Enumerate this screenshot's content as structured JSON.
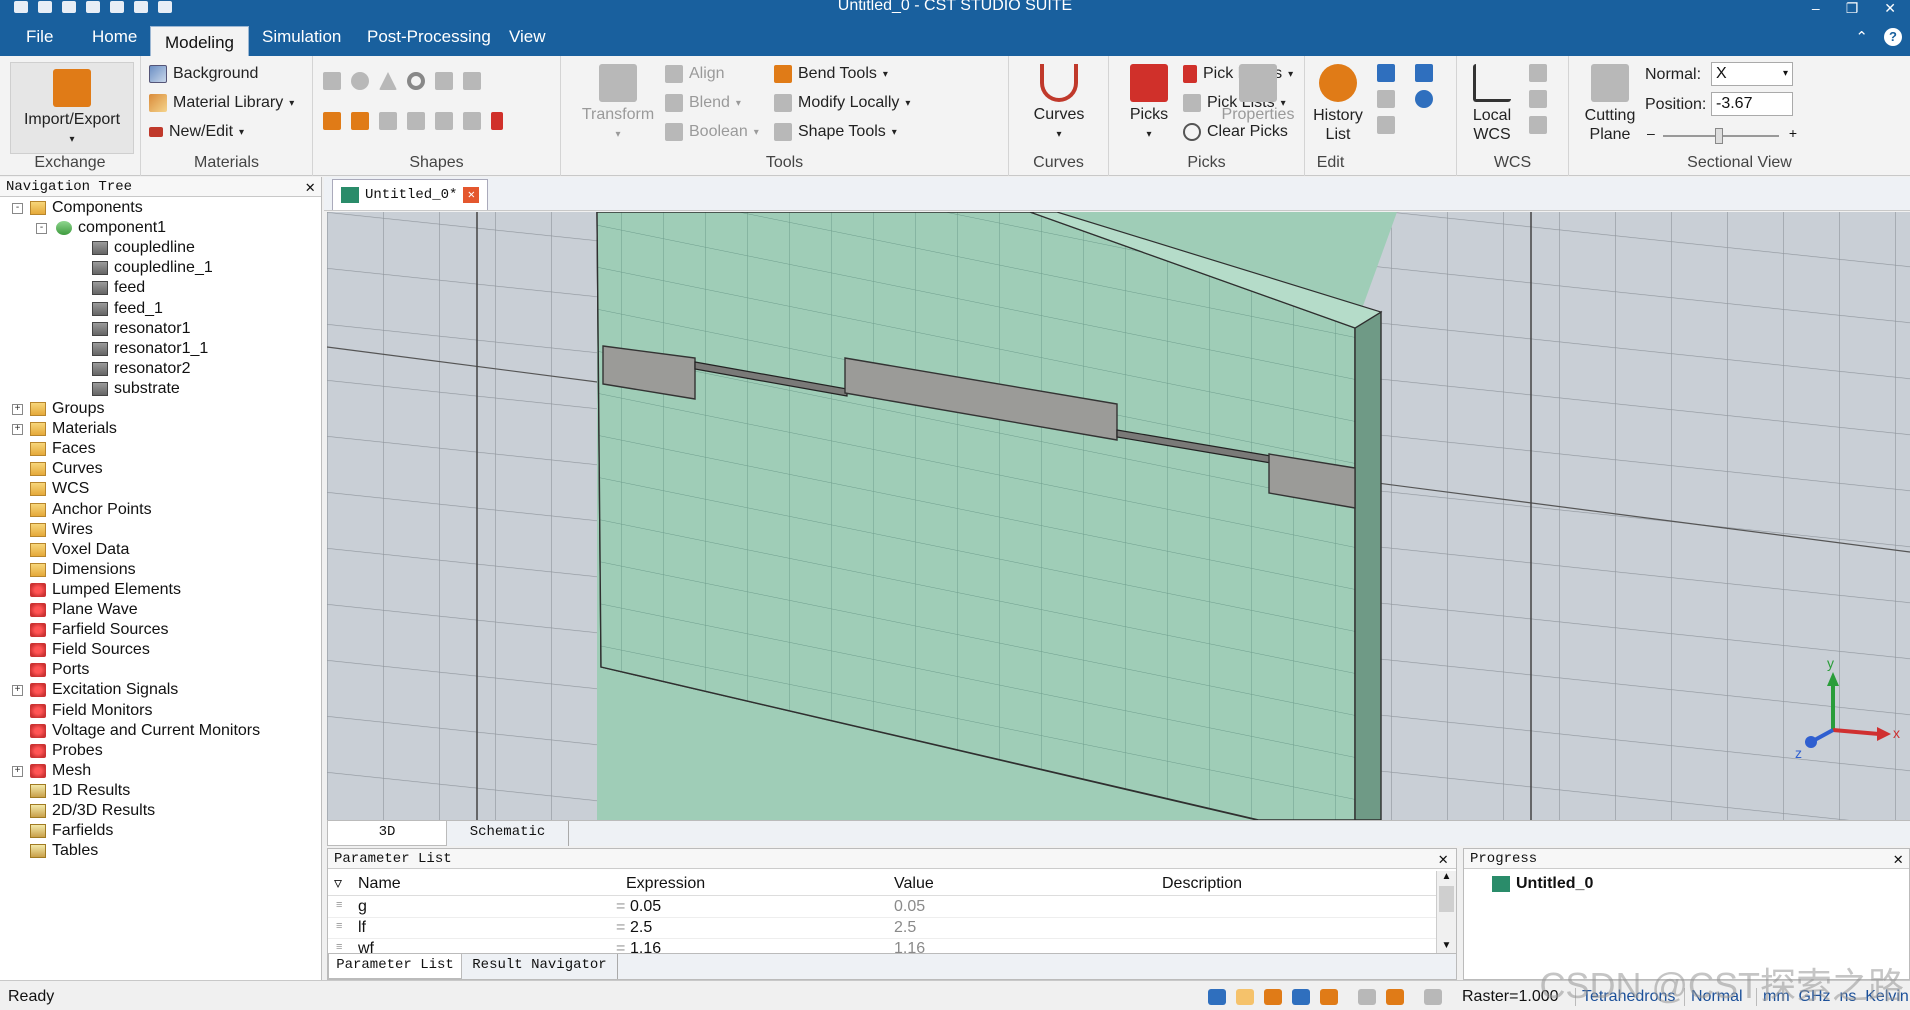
{
  "window": {
    "title": "Untitled_0 - CST STUDIO SUITE"
  },
  "menu": [
    "File",
    "Home",
    "Modeling",
    "Simulation",
    "Post-Processing",
    "View"
  ],
  "ribbon": {
    "exchange": {
      "import_export": "Import/Export",
      "label": "Exchange"
    },
    "materials": {
      "background": "Background",
      "material_library": "Material Library",
      "new_edit": "New/Edit",
      "label": "Materials"
    },
    "shapes": {
      "label": "Shapes"
    },
    "tools": {
      "transform": "Transform",
      "align": "Align",
      "blend": "Blend",
      "boolean": "Boolean",
      "bend_tools": "Bend Tools",
      "modify_locally": "Modify Locally",
      "shape_tools": "Shape Tools",
      "label": "Tools"
    },
    "curves": {
      "curves": "Curves",
      "label": "Curves"
    },
    "picks": {
      "picks": "Picks",
      "pick_points": "Pick Points",
      "pick_lists": "Pick Lists",
      "clear_picks": "Clear Picks",
      "label": "Picks"
    },
    "edit": {
      "properties": "Properties",
      "history_list": "History List",
      "label": "Edit"
    },
    "wcs": {
      "local_wcs": "Local WCS",
      "label": "WCS"
    },
    "sectional_view": {
      "cutting_plane": "Cutting Plane",
      "normal_label": "Normal:",
      "normal_value": "X",
      "position_label": "Position:",
      "position_value": "-3.67",
      "label": "Sectional View"
    }
  },
  "nav_tree": {
    "title": "Navigation Tree",
    "components_label": "Components",
    "component1": "component1",
    "solids": [
      "coupledline",
      "coupledline_1",
      "feed",
      "feed_1",
      "resonator1",
      "resonator1_1",
      "resonator2",
      "substrate"
    ],
    "folders": [
      "Groups",
      "Materials",
      "Faces",
      "Curves",
      "WCS",
      "Anchor Points",
      "Wires",
      "Voxel Data",
      "Dimensions",
      "Lumped Elements",
      "Plane Wave",
      "Farfield Sources",
      "Field Sources",
      "Ports",
      "Excitation Signals",
      "Field Monitors",
      "Voltage and Current Monitors",
      "Probes",
      "Mesh",
      "1D Results",
      "2D/3D Results",
      "Farfields",
      "Tables"
    ]
  },
  "document_tab": "Untitled_0*",
  "view_tabs": [
    "3D",
    "Schematic"
  ],
  "axes": {
    "x": "x",
    "y": "y",
    "z": "z"
  },
  "parameter_list": {
    "title": "Parameter List",
    "columns": [
      "Name",
      "Expression",
      "Value",
      "Description"
    ],
    "rows": [
      {
        "name": "g",
        "expression": "0.05",
        "value": "0.05"
      },
      {
        "name": "lf",
        "expression": "2.5",
        "value": "2.5"
      },
      {
        "name": "wf",
        "expression": "1.16",
        "value": "1.16"
      }
    ],
    "tabs": [
      "Parameter List",
      "Result Navigator"
    ]
  },
  "progress": {
    "title": "Progress",
    "item": "Untitled_0"
  },
  "status": {
    "ready": "Ready",
    "raster": "Raster=1.000",
    "mesh": "Tetrahedrons",
    "mode": "Normal",
    "units": "mm  GHz  ns  Kelvin"
  },
  "watermark": "CSDN @CST探索之路",
  "colors": {
    "title_bar": "#19609e",
    "substrate": "#9fcdb7",
    "metal": "#9b9b98",
    "viewport_bg": "#c9cfd6"
  }
}
